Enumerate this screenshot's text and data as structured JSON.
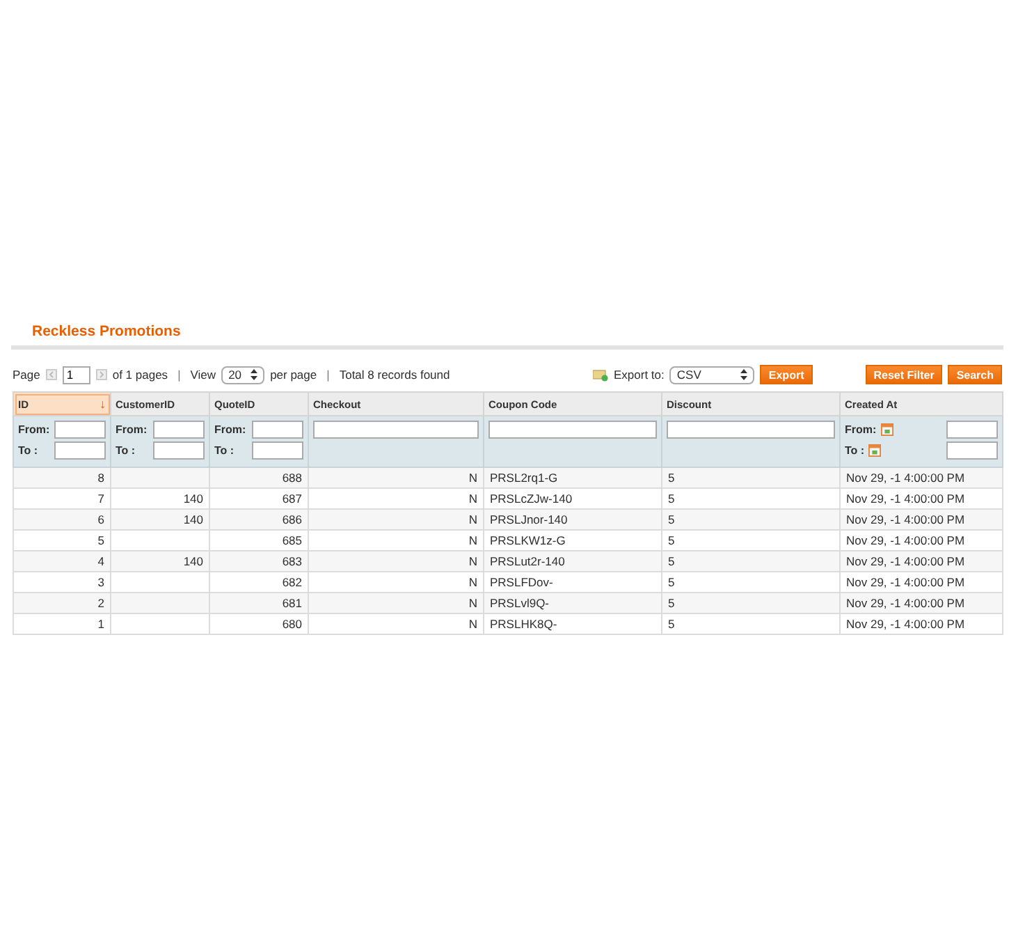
{
  "title": "Reckless Promotions",
  "pager": {
    "page_label": "Page",
    "page": "1",
    "of_pages": "of 1 pages",
    "separator": "|",
    "view_label": "View",
    "per_page": "20",
    "per_page_label": "per page",
    "total": "Total 8 records found"
  },
  "export": {
    "label": "Export to:",
    "format": "CSV",
    "button": "Export"
  },
  "actions": [
    "Reset Filter",
    "Search"
  ],
  "columns": [
    {
      "label": "ID",
      "kind": "number",
      "sorted": true,
      "sort_arrow": "↓",
      "filter": {
        "from": "From:",
        "to": "To :"
      }
    },
    {
      "label": "CustomerID",
      "kind": "number",
      "sorted": false,
      "filter": {
        "from": "From:",
        "to": "To :"
      }
    },
    {
      "label": "QuoteID",
      "kind": "number",
      "sorted": false,
      "filter": {
        "from": "From:",
        "to": "To :"
      }
    },
    {
      "label": "Checkout",
      "kind": "flag",
      "sorted": false
    },
    {
      "label": "Coupon Code",
      "kind": "text",
      "sorted": false
    },
    {
      "label": "Discount",
      "kind": "text",
      "sorted": false
    },
    {
      "label": "Created At",
      "kind": "date",
      "sorted": false,
      "filter": {
        "from": "From:",
        "to": "To :"
      }
    }
  ],
  "rows": [
    [
      "8",
      "",
      "688",
      "N",
      "PRSL2rq1-G",
      "5",
      "Nov 29, -1 4:00:00 PM"
    ],
    [
      "7",
      "140",
      "687",
      "N",
      "PRSLcZJw-140",
      "5",
      "Nov 29, -1 4:00:00 PM"
    ],
    [
      "6",
      "140",
      "686",
      "N",
      "PRSLJnor-140",
      "5",
      "Nov 29, -1 4:00:00 PM"
    ],
    [
      "5",
      "",
      "685",
      "N",
      "PRSLKW1z-G",
      "5",
      "Nov 29, -1 4:00:00 PM"
    ],
    [
      "4",
      "140",
      "683",
      "N",
      "PRSLut2r-140",
      "5",
      "Nov 29, -1 4:00:00 PM"
    ],
    [
      "3",
      "",
      "682",
      "N",
      "PRSLFDov-",
      "5",
      "Nov 29, -1 4:00:00 PM"
    ],
    [
      "2",
      "",
      "681",
      "N",
      "PRSLvl9Q-",
      "5",
      "Nov 29, -1 4:00:00 PM"
    ],
    [
      "1",
      "",
      "680",
      "N",
      "PRSLHK8Q-",
      "5",
      "Nov 29, -1 4:00:00 PM"
    ]
  ]
}
